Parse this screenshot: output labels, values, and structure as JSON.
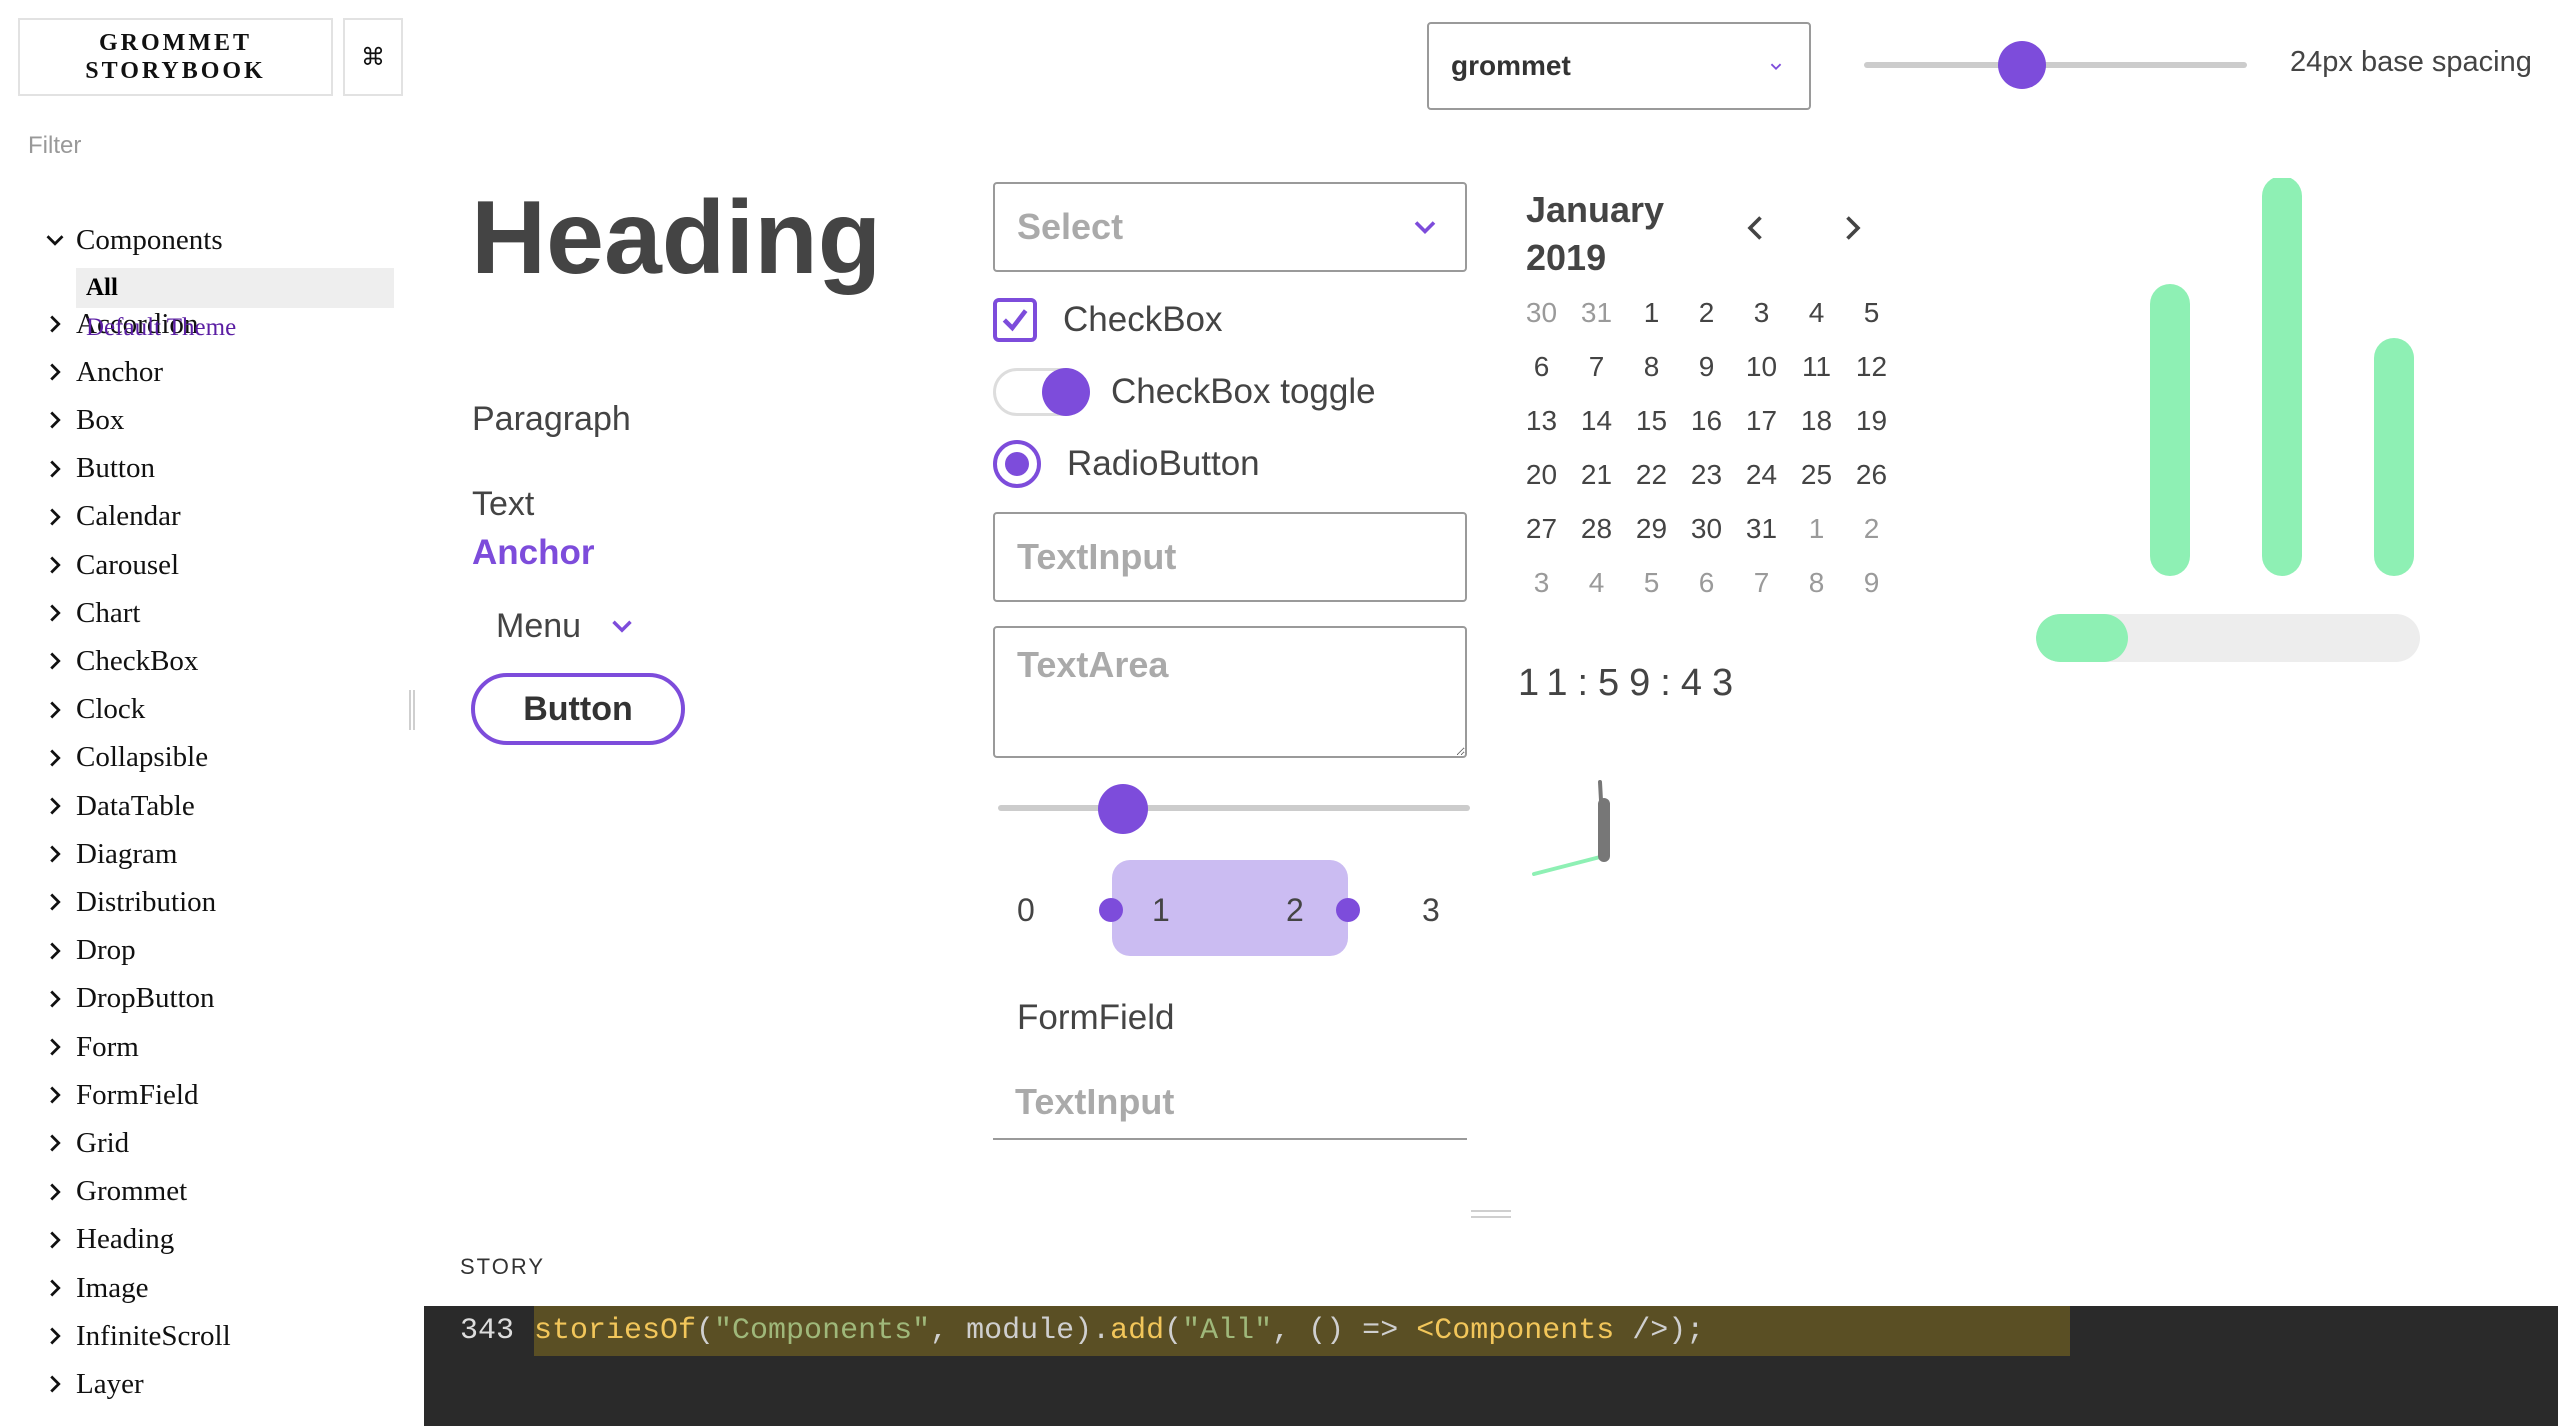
{
  "sidebar": {
    "brand_line1": "GROMMET",
    "brand_line2": "STORYBOOK",
    "shortcuts_icon": "⌘",
    "filter_placeholder": "Filter",
    "root_label": "Components",
    "root_children": [
      "All",
      "Default Theme"
    ],
    "items": [
      "Accordion",
      "Anchor",
      "Box",
      "Button",
      "Calendar",
      "Carousel",
      "Chart",
      "CheckBox",
      "Clock",
      "Collapsible",
      "DataTable",
      "Diagram",
      "Distribution",
      "Drop",
      "DropButton",
      "Form",
      "FormField",
      "Grid",
      "Grommet",
      "Heading",
      "Image",
      "InfiniteScroll",
      "Layer"
    ]
  },
  "toolbar": {
    "theme_value": "grommet",
    "spacing_slider_fraction": 0.42,
    "spacing_label": "24px base spacing"
  },
  "preview": {
    "heading": "Heading",
    "paragraph": "Paragraph",
    "text": "Text",
    "anchor": "Anchor",
    "menu": "Menu",
    "button": "Button",
    "select_placeholder": "Select",
    "checkbox_label": "CheckBox",
    "checkbox_checked": true,
    "toggle_label": "CheckBox toggle",
    "toggle_on": true,
    "radio_label": "RadioButton",
    "radio_selected": true,
    "textinput_placeholder": "TextInput",
    "textarea_placeholder": "TextArea",
    "range_fraction": 0.26,
    "range_selector": {
      "labels": [
        "0",
        "1",
        "2",
        "3"
      ],
      "selected": [
        1,
        2
      ]
    },
    "formfield_label": "FormField",
    "formfield_placeholder": "TextInput",
    "calendar": {
      "month": "January",
      "year": "2019",
      "days": [
        {
          "d": "30",
          "out": true
        },
        {
          "d": "31",
          "out": true
        },
        {
          "d": "1"
        },
        {
          "d": "2"
        },
        {
          "d": "3"
        },
        {
          "d": "4"
        },
        {
          "d": "5"
        },
        {
          "d": "6"
        },
        {
          "d": "7"
        },
        {
          "d": "8"
        },
        {
          "d": "9"
        },
        {
          "d": "10"
        },
        {
          "d": "11"
        },
        {
          "d": "12"
        },
        {
          "d": "13"
        },
        {
          "d": "14"
        },
        {
          "d": "15"
        },
        {
          "d": "16"
        },
        {
          "d": "17"
        },
        {
          "d": "18"
        },
        {
          "d": "19"
        },
        {
          "d": "20"
        },
        {
          "d": "21"
        },
        {
          "d": "22"
        },
        {
          "d": "23"
        },
        {
          "d": "24"
        },
        {
          "d": "25"
        },
        {
          "d": "26"
        },
        {
          "d": "27"
        },
        {
          "d": "28"
        },
        {
          "d": "29"
        },
        {
          "d": "30"
        },
        {
          "d": "31"
        },
        {
          "d": "1",
          "out": true
        },
        {
          "d": "2",
          "out": true
        },
        {
          "d": "3",
          "out": true
        },
        {
          "d": "4",
          "out": true
        },
        {
          "d": "5",
          "out": true
        },
        {
          "d": "6",
          "out": true
        },
        {
          "d": "7",
          "out": true
        },
        {
          "d": "8",
          "out": true
        },
        {
          "d": "9",
          "out": true
        }
      ]
    },
    "digital_clock": "11:59:43",
    "chart_data": {
      "type": "bar",
      "categories": [
        "",
        "",
        ""
      ],
      "values": [
        70,
        100,
        55
      ],
      "ylim": [
        0,
        100
      ],
      "color": "#8ef0b4"
    },
    "meter_fraction": 0.24,
    "meter_color": "#8ef0b4"
  },
  "story": {
    "title": "STORY",
    "line_number": "343",
    "code_tokens": [
      {
        "t": "storiesOf",
        "k": "fn"
      },
      {
        "t": "(",
        "k": "plain"
      },
      {
        "t": "\"Components\"",
        "k": "str"
      },
      {
        "t": ", module).",
        "k": "plain"
      },
      {
        "t": "add",
        "k": "fn"
      },
      {
        "t": "(",
        "k": "plain"
      },
      {
        "t": "\"All\"",
        "k": "str"
      },
      {
        "t": ", () => ",
        "k": "plain"
      },
      {
        "t": "<Components",
        "k": "fn"
      },
      {
        "t": " />);",
        "k": "plain"
      }
    ]
  },
  "colors": {
    "brand": "#7d4cdb",
    "accent_green": "#8ef0b4",
    "link_purple": "#5b1ea3",
    "code_bg": "#2a2a2a",
    "code_highlight": "#5a4f24"
  },
  "icons": {
    "tree_collapsed": "chevron-right-icon",
    "tree_expanded": "chevron-down-icon",
    "calendar_prev": "chevron-left-icon",
    "calendar_next": "chevron-right-icon"
  }
}
